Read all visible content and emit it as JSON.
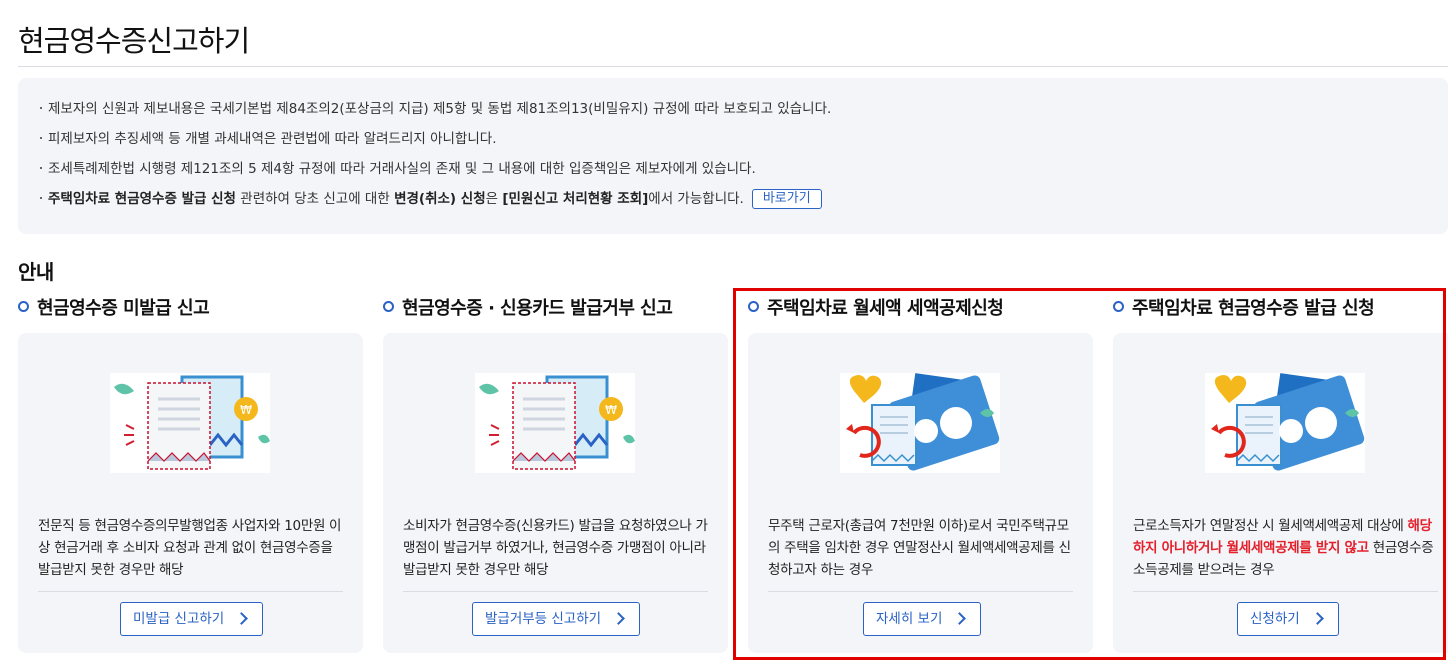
{
  "page": {
    "title": "현금영수증신고하기"
  },
  "notice": {
    "line1": "제보자의 신원과 제보내용은 국세기본법 제84조의2(포상금의 지급) 제5항 및 동법 제81조의13(비밀유지) 규정에 따라 보호되고 있습니다.",
    "line2": "피제보자의 추징세액 등 개별 과세내역은 관련법에 따라 알려드리지 아니합니다.",
    "line3": "조세특례제한법 시행령 제121조의 5 제4항 규정에 따라 거래사실의 존재 및 그 내용에 대한 입증책임은 제보자에게 있습니다.",
    "line4": {
      "bold1": "주택임차료 현금영수증 발급 신청",
      "text1": " 관련하여 당초 신고에 대한 ",
      "bold2": "변경(취소) 신청",
      "text2": "은 ",
      "bold3": "[민원신고 처리현황 조회]",
      "text3": "에서 가능합니다.",
      "button": "바로가기"
    }
  },
  "guide": {
    "title": "안내",
    "cards": [
      {
        "heading": "현금영수증 미발급 신고",
        "desc": "전문직 등 현금영수증의무발행업종 사업자와 10만원 이상 현금거래 후 소비자 요청과 관계 없이 현금영수증을 발급받지 못한 경우만 해당",
        "button": "미발급 신고하기",
        "illustration": "receipt-coin-illustration"
      },
      {
        "heading": "현금영수증 · 신용카드 발급거부 신고",
        "desc": "소비자가 현금영수증(신용카드) 발급을 요청하였으나 가맹점이 발급거부 하였거나, 현금영수증 가맹점이 아니라 발급받지 못한 경우만 해당",
        "button": "발급거부등 신고하기",
        "illustration": "receipt-coin-illustration"
      },
      {
        "heading": "주택임차료 월세액 세액공제신청",
        "desc": "무주택 근로자(총급여 7천만원 이하)로서 국민주택규모의 주택을 임차한 경우 연말정산시 월세액세액공제를 신청하고자 하는 경우",
        "button": "자세히 보기",
        "illustration": "rent-refund-illustration"
      },
      {
        "heading": "주택임차료 현금영수증 발급 신청",
        "desc_pre": "근로소득자가 연말정산 시 월세액세액공제 대상에 ",
        "desc_emph": "해당하지 아니하거나 월세세액공제를 받지 않고",
        "desc_post": " 현금영수증 소득공제를 받으려는 경우",
        "button": "신청하기",
        "illustration": "rent-refund-illustration"
      }
    ]
  },
  "colors": {
    "accent": "#2a62c5",
    "emphasis": "#e4202b",
    "highlight_box": "#e10000",
    "card_bg": "#f3f5f9"
  }
}
